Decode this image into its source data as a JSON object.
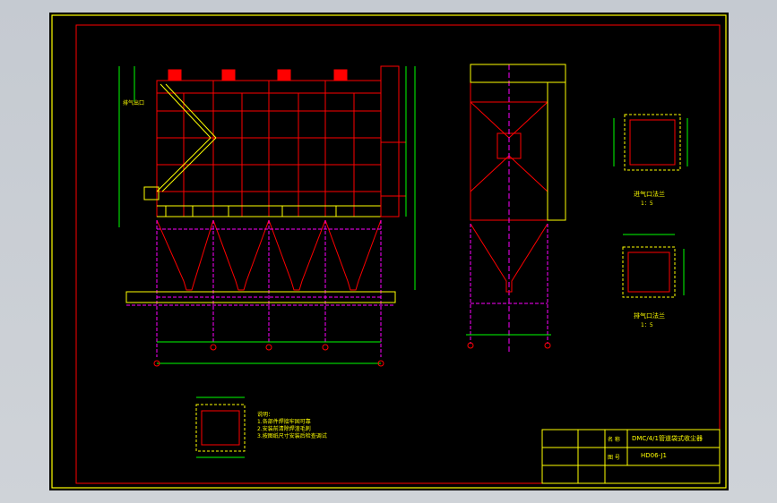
{
  "drawing": {
    "title_block": {
      "row1_label": "名 称",
      "row1_value": "DMC/4/1管道袋式收尘器",
      "row2_label": "图 号",
      "row2_value": "HD06-J1"
    },
    "notes": {
      "heading": "说明：",
      "lines": [
        "1.各部件焊接牢固可靠",
        "2.安装前清除焊渣毛刺",
        "3.按图纸尺寸安装后检查调试"
      ]
    },
    "detail_labels": {
      "inlet_flange": "进气口法兰",
      "inlet_scale": "1：5",
      "outlet_flange": "排气口法兰",
      "outlet_scale": "1：5"
    },
    "side_label": "排气出口",
    "colors": {
      "frame": "#ffff00",
      "structure": "#ff0000",
      "dimension": "#00ff00",
      "centerline": "#ff00ff",
      "background": "#000000"
    }
  }
}
